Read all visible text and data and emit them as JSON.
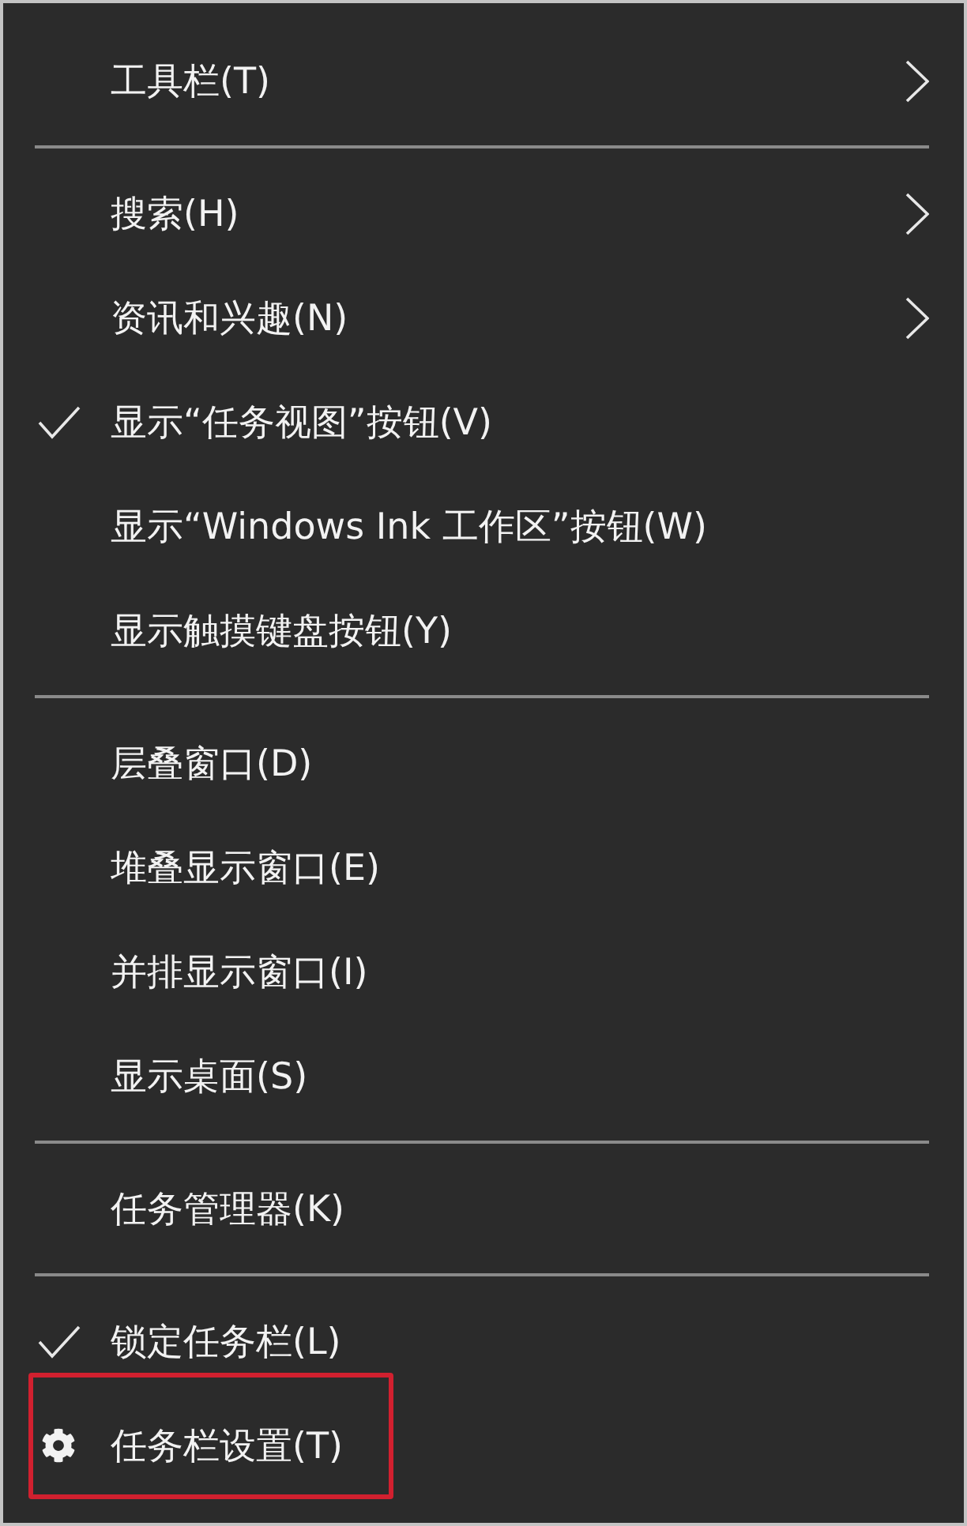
{
  "menu": {
    "groups": [
      {
        "items": [
          {
            "label": "工具栏(T)",
            "kind": "submenu",
            "checked": false,
            "highlighted": false
          }
        ]
      },
      {
        "items": [
          {
            "label": "搜索(H)",
            "kind": "submenu",
            "checked": false,
            "highlighted": false
          },
          {
            "label": "资讯和兴趣(N)",
            "kind": "submenu",
            "checked": false,
            "highlighted": false
          },
          {
            "label": "显示“任务视图”按钮(V)",
            "kind": "command",
            "checked": true,
            "highlighted": false
          },
          {
            "label": "显示“Windows Ink 工作区”按钮(W)",
            "kind": "command",
            "checked": false,
            "highlighted": false
          },
          {
            "label": "显示触摸键盘按钮(Y)",
            "kind": "command",
            "checked": false,
            "highlighted": false
          }
        ]
      },
      {
        "items": [
          {
            "label": "层叠窗口(D)",
            "kind": "command",
            "checked": false,
            "highlighted": false
          },
          {
            "label": "堆叠显示窗口(E)",
            "kind": "command",
            "checked": false,
            "highlighted": false
          },
          {
            "label": "并排显示窗口(I)",
            "kind": "command",
            "checked": false,
            "highlighted": false
          },
          {
            "label": "显示桌面(S)",
            "kind": "command",
            "checked": false,
            "highlighted": false
          }
        ]
      },
      {
        "items": [
          {
            "label": "任务管理器(K)",
            "kind": "command",
            "checked": false,
            "highlighted": false
          }
        ]
      },
      {
        "items": [
          {
            "label": "锁定任务栏(L)",
            "kind": "command",
            "checked": true,
            "highlighted": false
          },
          {
            "label": "任务栏设置(T)",
            "kind": "settings",
            "checked": false,
            "highlighted": true
          }
        ]
      }
    ]
  }
}
